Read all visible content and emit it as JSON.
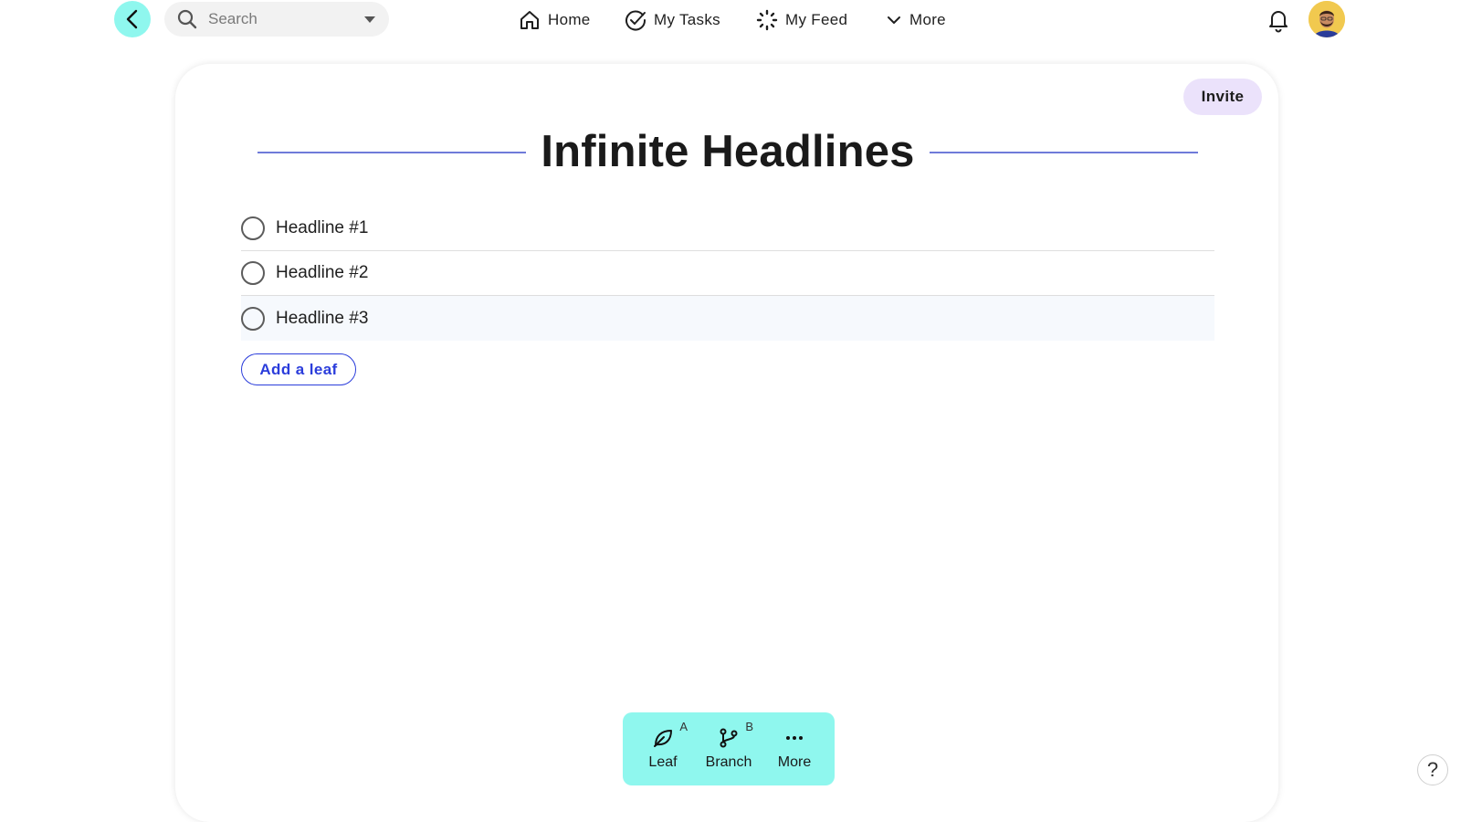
{
  "nav": {
    "search_placeholder": "Search",
    "items": [
      {
        "label": "Home",
        "icon": "home-icon"
      },
      {
        "label": "My Tasks",
        "icon": "check-circle-icon"
      },
      {
        "label": "My Feed",
        "icon": "sparkle-icon"
      },
      {
        "label": "More",
        "icon": "chevron-down-icon"
      }
    ]
  },
  "page": {
    "invite_label": "Invite",
    "title": "Infinite Headlines",
    "rows": [
      {
        "label": "Headline #1"
      },
      {
        "label": "Headline #2"
      },
      {
        "label": "Headline #3"
      }
    ],
    "add_leaf_label": "Add a leaf"
  },
  "toolbar": {
    "tools": [
      {
        "label": "Leaf",
        "shortcut": "A",
        "icon": "leaf-icon"
      },
      {
        "label": "Branch",
        "shortcut": "B",
        "icon": "branch-icon"
      },
      {
        "label": "More",
        "shortcut": "",
        "icon": "more-dots-icon"
      }
    ]
  },
  "help": {
    "label": "?"
  },
  "colors": {
    "accent_cyan": "#8ff7ee",
    "link_blue": "#2b3ddb",
    "invite_bg": "#ebe2fb",
    "title_rule": "#6f7bd9"
  }
}
